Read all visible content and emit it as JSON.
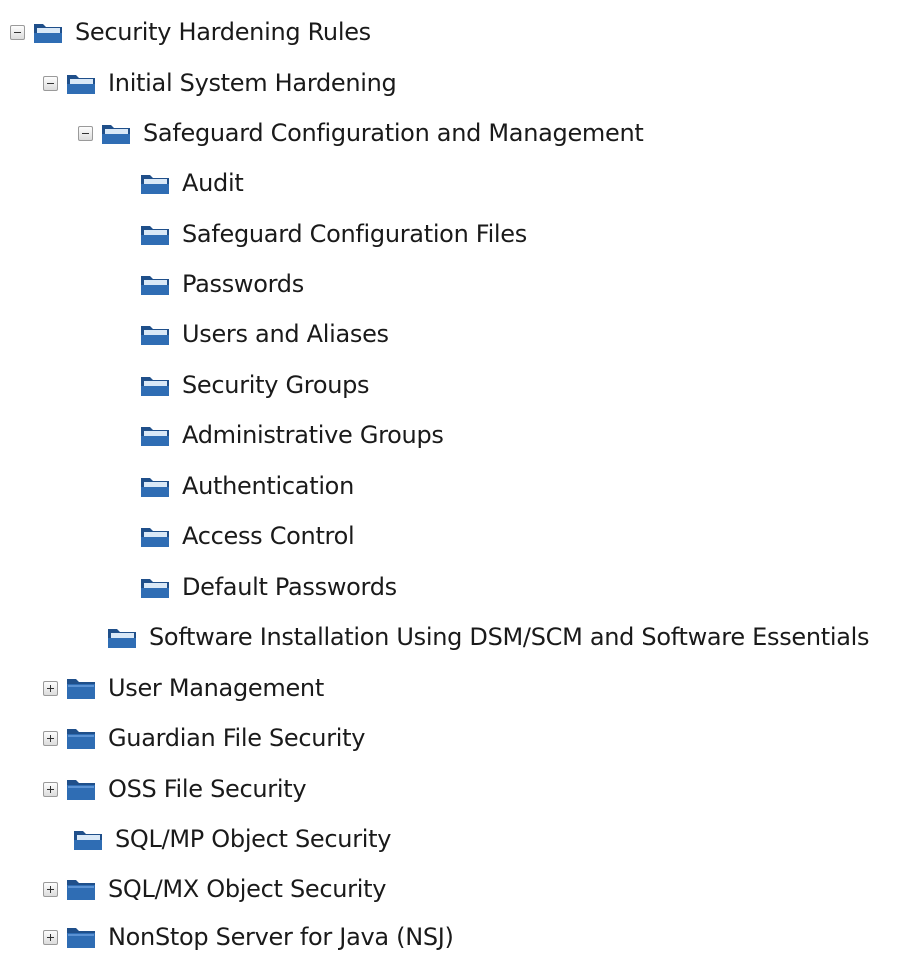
{
  "tree": {
    "items": [
      {
        "label": "Security Hardening Rules",
        "toggle": "minus",
        "folder": "open-folder-icon"
      },
      {
        "label": "Initial System Hardening",
        "toggle": "minus",
        "folder": "open-folder-icon"
      },
      {
        "label": "Safeguard Configuration and Management",
        "toggle": "minus",
        "folder": "open-folder-icon"
      },
      {
        "label": "Audit",
        "toggle": "none",
        "folder": "open-folder-icon"
      },
      {
        "label": "Safeguard Configuration Files",
        "toggle": "none",
        "folder": "open-folder-icon"
      },
      {
        "label": "Passwords",
        "toggle": "none",
        "folder": "open-folder-icon"
      },
      {
        "label": "Users and Aliases",
        "toggle": "none",
        "folder": "open-folder-icon"
      },
      {
        "label": "Security Groups",
        "toggle": "none",
        "folder": "open-folder-icon"
      },
      {
        "label": "Administrative Groups",
        "toggle": "none",
        "folder": "open-folder-icon"
      },
      {
        "label": "Authentication",
        "toggle": "none",
        "folder": "open-folder-icon"
      },
      {
        "label": "Access Control",
        "toggle": "none",
        "folder": "open-folder-icon"
      },
      {
        "label": "Default Passwords",
        "toggle": "none",
        "folder": "open-folder-icon"
      },
      {
        "label": "Software Installation Using DSM/SCM and Software Essentials",
        "toggle": "none",
        "folder": "open-folder-icon"
      },
      {
        "label": "User Management",
        "toggle": "plus",
        "folder": "closed-folder-icon"
      },
      {
        "label": "Guardian File Security",
        "toggle": "plus",
        "folder": "closed-folder-icon"
      },
      {
        "label": "OSS File Security",
        "toggle": "plus",
        "folder": "closed-folder-icon"
      },
      {
        "label": "SQL/MP Object Security",
        "toggle": "none",
        "folder": "open-folder-icon"
      },
      {
        "label": "SQL/MX Object Security",
        "toggle": "plus",
        "folder": "closed-folder-icon"
      },
      {
        "label": "NonStop Server for Java (NSJ)",
        "toggle": "plus",
        "folder": "closed-folder-icon"
      }
    ]
  },
  "colors": {
    "folder_fill": "#2f6db4",
    "folder_dark": "#1f4f8a",
    "folder_light": "#d9e8f7"
  }
}
